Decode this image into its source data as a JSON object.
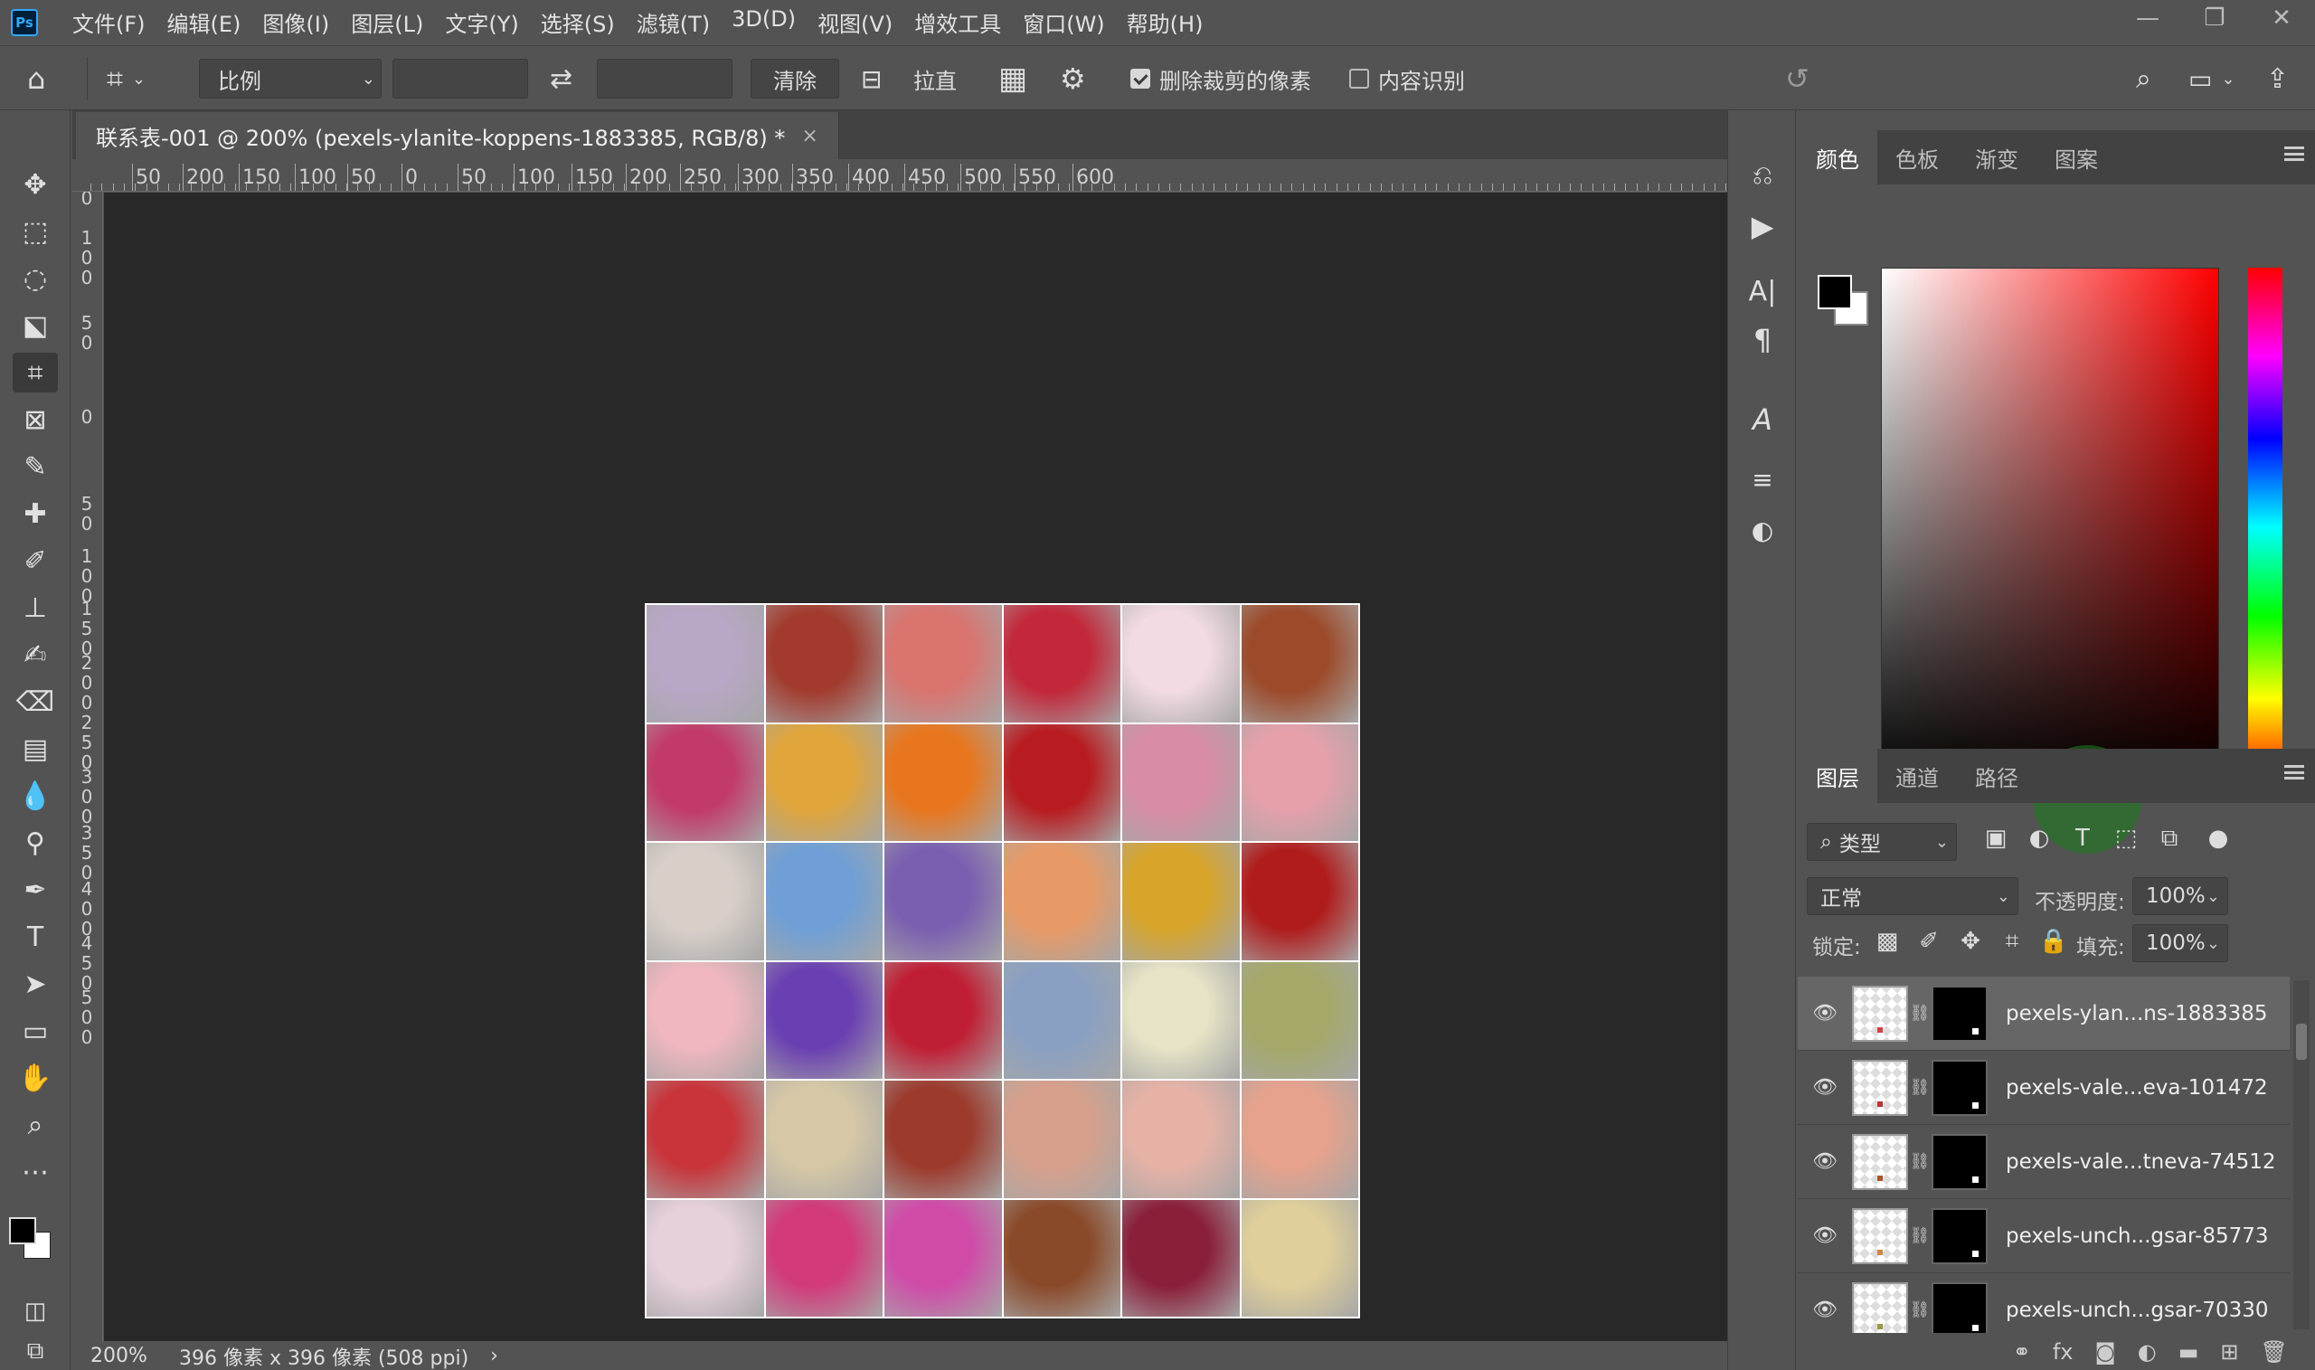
{
  "app": {
    "logo": "Ps"
  },
  "menu": [
    "文件(F)",
    "编辑(E)",
    "图像(I)",
    "图层(L)",
    "文字(Y)",
    "选择(S)",
    "滤镜(T)",
    "3D(D)",
    "视图(V)",
    "增效工具",
    "窗口(W)",
    "帮助(H)"
  ],
  "options": {
    "ratio": "比例",
    "clear": "清除",
    "straighten": "拉直",
    "delete_cropped": "删除裁剪的像素",
    "delete_cropped_checked": true,
    "content_aware": "内容识别",
    "content_aware_checked": false
  },
  "document": {
    "tab_title": "联系表-001 @ 200% (pexels-ylanite-koppens-1883385, RGB/8) *",
    "close": "×",
    "zoom": "200%",
    "info": "396 像素 x 396 像素 (508 ppi)",
    "info_arrow": "›"
  },
  "ruler_top": [
    "50",
    "200",
    "150",
    "100",
    "50",
    "0",
    "50",
    "100",
    "150",
    "200",
    "250",
    "300",
    "350",
    "400",
    "450",
    "500",
    "550",
    "600"
  ],
  "ruler_left": [
    "0",
    "100",
    "50",
    "0",
    "50",
    "100",
    "150",
    "200",
    "250",
    "300",
    "350",
    "400",
    "450",
    "500"
  ],
  "photo_colors": [
    [
      "#b8a7c6",
      "#a23b2e",
      "#d9746f",
      "#c2283a",
      "#f2dbe3",
      "#9c4a2a"
    ],
    [
      "#c23a6a",
      "#e0a53a",
      "#e8761e",
      "#b81c20",
      "#d98ca5",
      "#e5a0aa"
    ],
    [
      "#d8cfc9",
      "#6f9fd6",
      "#7a5fb0",
      "#e89a66",
      "#d8a52a",
      "#b01c1c"
    ],
    [
      "#f0b7bf",
      "#6a3fb2",
      "#c01e34",
      "#8aa0c2",
      "#e6e3c6",
      "#a5a868"
    ],
    [
      "#c8343a",
      "#d6c8a6",
      "#9c3a2c",
      "#d7a08c",
      "#e6b2a6",
      "#e6a28c"
    ],
    [
      "#e6d0dc",
      "#d23a7a",
      "#d04aa8",
      "#8a4a2a",
      "#8a1f3a",
      "#e0cf9a"
    ]
  ],
  "color_panel": {
    "tabs": [
      "颜色",
      "色板",
      "渐变",
      "图案"
    ],
    "active": "颜色"
  },
  "layers_panel": {
    "tabs": [
      "图层",
      "通道",
      "路径"
    ],
    "active": "图层",
    "filter": "类型",
    "blend_mode": "正常",
    "opacity_label": "不透明度:",
    "opacity": "100%",
    "lock_label": "锁定:",
    "fill_label": "填充:",
    "fill": "100%",
    "layers": [
      {
        "name": "pexels-ylan...ns-1883385",
        "selected": true
      },
      {
        "name": "pexels-vale...eva-101472",
        "selected": false
      },
      {
        "name": "pexels-vale...tneva-74512",
        "selected": false
      },
      {
        "name": "pexels-unch...gsar-85773",
        "selected": false
      },
      {
        "name": "pexels-unch...gsar-70330",
        "selected": false
      }
    ]
  },
  "colors": {
    "foreground": "#000000",
    "background": "#ffffff",
    "ui_bg": "#535353",
    "canvas_bg": "#282828"
  }
}
